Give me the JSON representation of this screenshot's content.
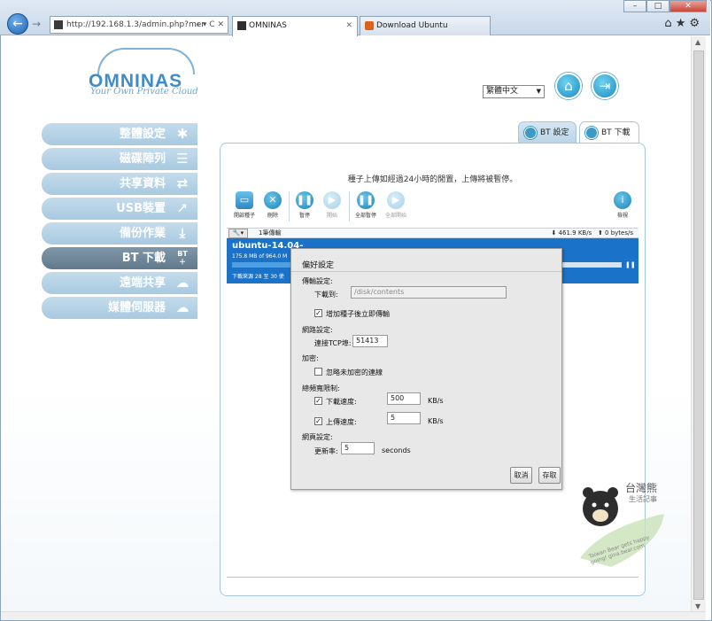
{
  "browser": {
    "window_buttons": [
      "–",
      "□",
      "✕"
    ],
    "address": "http://192.168.1.3/admin.php?mer",
    "address_controls": "⌕ ▾ C ✕",
    "tabs": [
      {
        "label": "OMNINAS"
      },
      {
        "label": "Download Ubuntu"
      }
    ],
    "toolbar_icons": [
      "home-icon",
      "star-icon",
      "gear-icon"
    ]
  },
  "logo": {
    "name": "OMNINAS",
    "tagline": "Your Own Private Cloud"
  },
  "header": {
    "language": "繁體中文"
  },
  "sidebar": {
    "items": [
      {
        "label": "整體設定",
        "icon": "tools-icon"
      },
      {
        "label": "磁碟陣列",
        "icon": "disks-icon"
      },
      {
        "label": "共享資料",
        "icon": "share-arrows-icon"
      },
      {
        "label": "USB裝置",
        "icon": "usb-icon"
      },
      {
        "label": "備份作業",
        "icon": "backup-icon"
      },
      {
        "label": "BT 下載",
        "icon": "bt-icon",
        "icon_text": "BT",
        "active": true
      },
      {
        "label": "遠端共享",
        "icon": "cloud-share-icon"
      },
      {
        "label": "媒體伺服器",
        "icon": "media-cloud-icon"
      }
    ]
  },
  "panel": {
    "tabs": [
      {
        "label": "BT 設定"
      },
      {
        "label": "BT 下載",
        "active": true
      }
    ],
    "notice": "種子上傳如經過24小時的閒置，上傳將被暫停。",
    "toolbar": [
      {
        "label": "開啟種子",
        "icon": "open-folder-icon"
      },
      {
        "label": "刪除",
        "icon": "delete-icon"
      },
      {
        "label": "暫停",
        "icon": "pause-icon"
      },
      {
        "label": "開始",
        "icon": "play-icon",
        "disabled": true
      },
      {
        "label": "全部暫停",
        "icon": "pause-all-icon"
      },
      {
        "label": "全部開始",
        "icon": "play-all-icon",
        "disabled": true
      },
      {
        "label": "檢視",
        "icon": "info-icon"
      }
    ],
    "status": {
      "count": "1筆傳輸",
      "down_speed": "⬇ 461.9 KB/s",
      "up_speed": "⬆ 0 bytes/s"
    },
    "torrent": {
      "name": "ubuntu-14.04-",
      "size": "175.8 MB of 964.0 M",
      "progress": 0.182,
      "eta": "下載來源 28 至 30 使"
    }
  },
  "dialog": {
    "title": "偏好設定",
    "transfer": {
      "heading": "傳輸設定:",
      "download_to_label": "下載到:",
      "download_to_value": "/disk/contents",
      "start_on_add_label": "增加種子後立即傳輸",
      "start_on_add_checked": true
    },
    "network": {
      "heading": "網路設定:",
      "port_label": "連接TCP埠:",
      "port_value": "51413"
    },
    "encryption": {
      "heading": "加密:",
      "ignore_unencrypted_label": "忽略未加密的連線",
      "ignore_unencrypted_checked": false
    },
    "bandwidth": {
      "heading": "總頻寬限制:",
      "download_label": "下載速度:",
      "download_value": "500",
      "download_checked": true,
      "upload_label": "上傳速度:",
      "upload_value": "5",
      "upload_checked": true,
      "unit": "KB/s"
    },
    "page": {
      "heading": "網頁設定:",
      "refresh_label": "更新率:",
      "refresh_value": "5",
      "refresh_unit": "seconds"
    },
    "buttons": {
      "cancel": "取消",
      "save": "存取"
    }
  },
  "watermark": {
    "title": "台灣熊",
    "subtitle": "生活記事",
    "caption": "Taiwan Bear gets happy going! gina.bear.com"
  }
}
